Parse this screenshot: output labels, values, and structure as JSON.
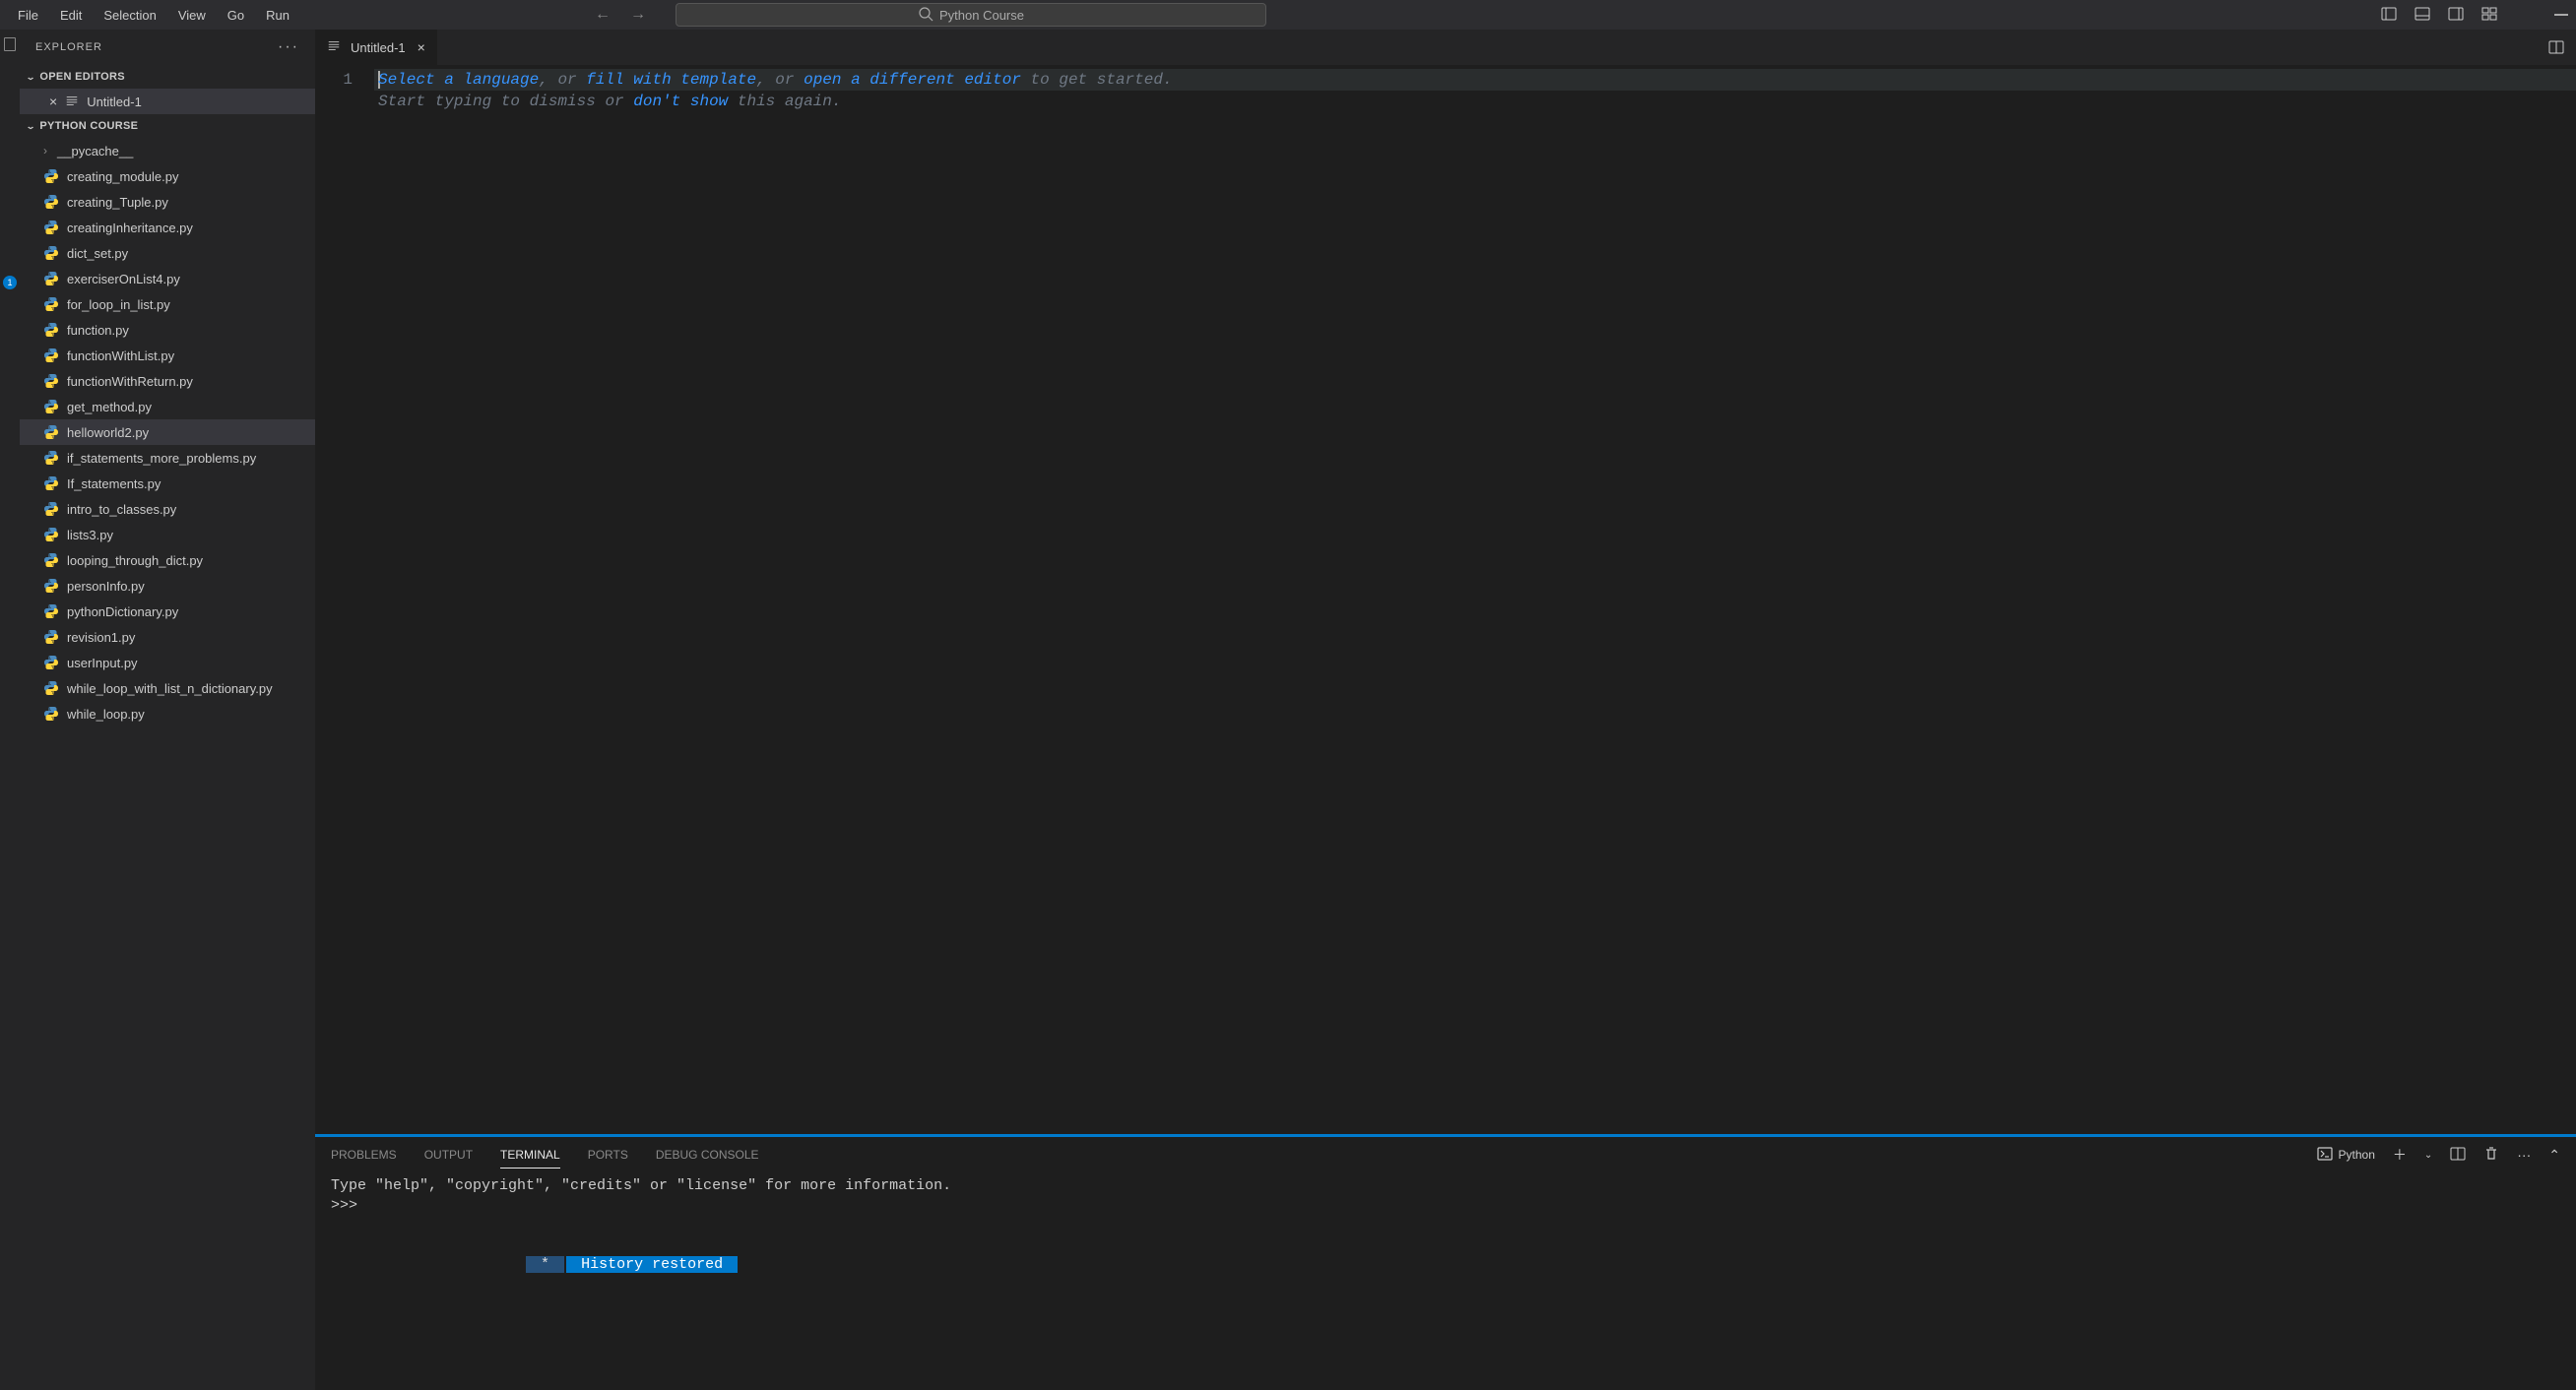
{
  "menubar": {
    "items": [
      "File",
      "Edit",
      "Selection",
      "View",
      "Go",
      "Run"
    ],
    "command_center": "Python Course"
  },
  "explorer": {
    "title": "EXPLORER",
    "open_editors_label": "OPEN EDITORS",
    "open_editor": "Untitled-1",
    "project_label": "PYTHON COURSE",
    "folders": [
      "__pycache__"
    ],
    "files": [
      "creating_module.py",
      "creating_Tuple.py",
      "creatingInheritance.py",
      "dict_set.py",
      "exerciserOnList4.py",
      "for_loop_in_list.py",
      "function.py",
      "functionWithList.py",
      "functionWithReturn.py",
      "get_method.py",
      "helloworld2.py",
      "if_statements_more_problems.py",
      "If_statements.py",
      "intro_to_classes.py",
      "lists3.py",
      "looping_through_dict.py",
      "personInfo.py",
      "pythonDictionary.py",
      "revision1.py",
      "userInput.py",
      "while_loop_with_list_n_dictionary.py",
      "while_loop.py"
    ],
    "selected_file": "helloworld2.py"
  },
  "tabs": {
    "active": "Untitled-1"
  },
  "editor": {
    "line_number": "1",
    "placeholder": {
      "link1": "Select a language",
      "sep1": ", or ",
      "link2": "fill with template",
      "sep2": ", or ",
      "link3": "open a different editor",
      "tail1": " to get started.",
      "line2_a": "Start typing to dismiss or ",
      "link4": "don't show",
      "line2_b": " this again."
    }
  },
  "panel": {
    "tabs": [
      "PROBLEMS",
      "OUTPUT",
      "TERMINAL",
      "PORTS",
      "DEBUG CONSOLE"
    ],
    "active_tab": "TERMINAL",
    "terminal_type": "Python",
    "terminal": {
      "line1": "Type \"help\", \"copyright\", \"credits\" or \"license\" for more information.",
      "prompt": ">>> ",
      "history_star": " * ",
      "history_text": " History restored "
    }
  },
  "activity_badge": "1"
}
